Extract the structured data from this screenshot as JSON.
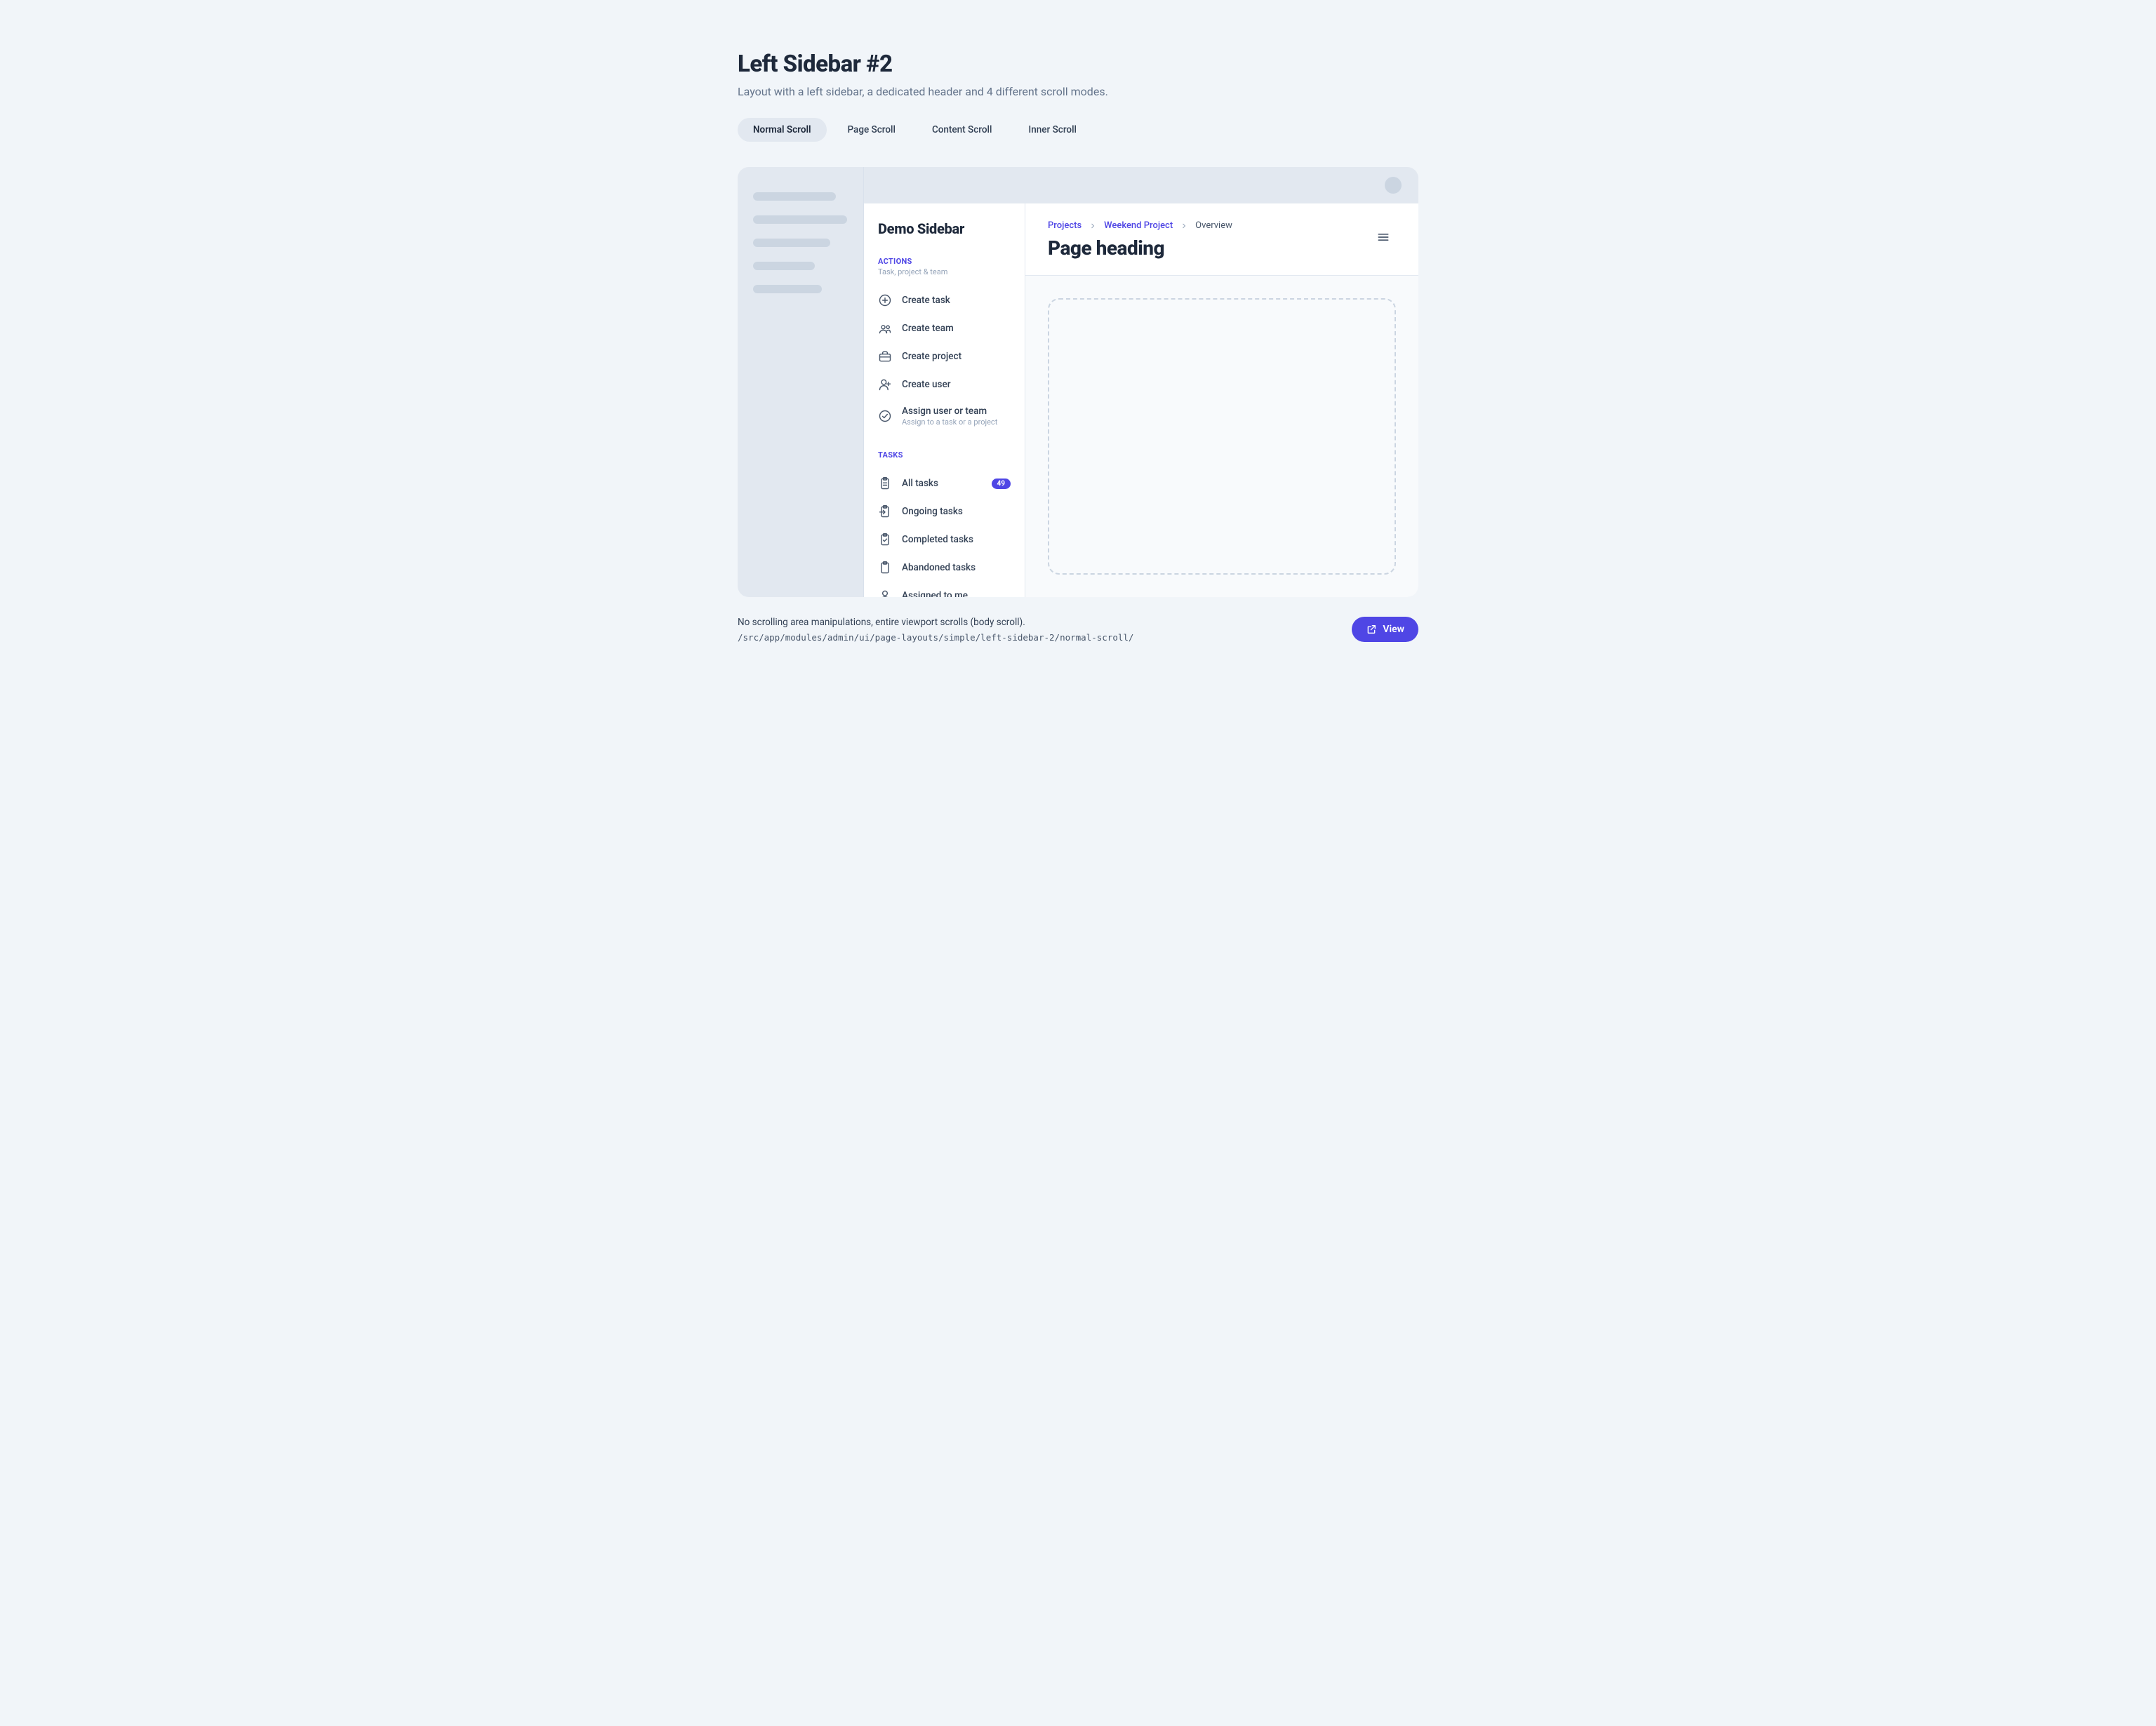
{
  "header": {
    "title": "Left Sidebar #2",
    "subtitle": "Layout with a left sidebar, a dedicated header and 4 different scroll modes."
  },
  "tabs": [
    {
      "label": "Normal Scroll",
      "active": true
    },
    {
      "label": "Page Scroll",
      "active": false
    },
    {
      "label": "Content Scroll",
      "active": false
    },
    {
      "label": "Inner Scroll",
      "active": false
    }
  ],
  "sidebar": {
    "title": "Demo Sidebar",
    "sections": [
      {
        "heading": "ACTIONS",
        "subheading": "Task, project & team",
        "items": [
          {
            "icon": "plus-circle-icon",
            "label": "Create task"
          },
          {
            "icon": "users-icon",
            "label": "Create team"
          },
          {
            "icon": "briefcase-icon",
            "label": "Create project"
          },
          {
            "icon": "user-plus-icon",
            "label": "Create user"
          },
          {
            "icon": "check-circle-icon",
            "label": "Assign user or team",
            "desc": "Assign to a task or a project"
          }
        ]
      },
      {
        "heading": "TASKS",
        "items": [
          {
            "icon": "clipboard-list-icon",
            "label": "All tasks",
            "badge": "49"
          },
          {
            "icon": "clipboard-import-icon",
            "label": "Ongoing tasks"
          },
          {
            "icon": "clipboard-check-icon",
            "label": "Completed tasks"
          },
          {
            "icon": "clipboard-icon",
            "label": "Abandoned tasks"
          },
          {
            "icon": "user-icon",
            "label": "Assigned to me"
          }
        ]
      }
    ]
  },
  "main": {
    "breadcrumb": [
      {
        "label": "Projects",
        "link": true
      },
      {
        "label": "Weekend Project",
        "link": true
      },
      {
        "label": "Overview",
        "link": false
      }
    ],
    "heading": "Page heading"
  },
  "footer": {
    "desc": "No scrolling area manipulations, entire viewport scrolls (body scroll).",
    "path": "/src/app/modules/admin/ui/page-layouts/simple/left-sidebar-2/normal-scroll/",
    "view_label": "View"
  }
}
